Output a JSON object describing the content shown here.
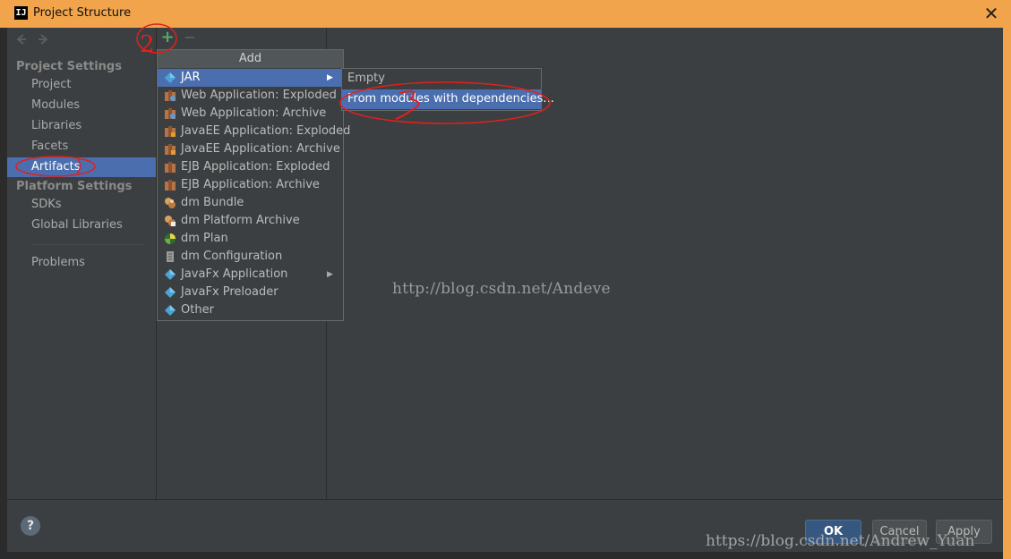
{
  "window": {
    "app_icon": "IJ",
    "title": "Project Structure",
    "close_glyph": "✕"
  },
  "sidebar": {
    "project_settings_heading": "Project Settings",
    "project_items": [
      {
        "label": "Project"
      },
      {
        "label": "Modules"
      },
      {
        "label": "Libraries"
      },
      {
        "label": "Facets"
      },
      {
        "label": "Artifacts",
        "selected": true
      }
    ],
    "platform_settings_heading": "Platform Settings",
    "platform_items": [
      {
        "label": "SDKs"
      },
      {
        "label": "Global Libraries"
      }
    ],
    "problems_label": "Problems"
  },
  "toolbar": {
    "add_glyph": "+",
    "remove_glyph": "−"
  },
  "add_menu": {
    "title": "Add",
    "items": [
      {
        "label": "JAR",
        "icon": "jar-icon",
        "submenu": true,
        "highlighted": true
      },
      {
        "label": "Web Application: Exploded",
        "icon": "web-app-icon"
      },
      {
        "label": "Web Application: Archive",
        "icon": "web-app-icon"
      },
      {
        "label": "JavaEE Application: Exploded",
        "icon": "javaee-icon"
      },
      {
        "label": "JavaEE Application: Archive",
        "icon": "javaee-icon"
      },
      {
        "label": "EJB Application: Exploded",
        "icon": "ejb-icon"
      },
      {
        "label": "EJB Application: Archive",
        "icon": "ejb-icon"
      },
      {
        "label": "dm Bundle",
        "icon": "dm-bundle-icon"
      },
      {
        "label": "dm Platform Archive",
        "icon": "dm-platform-icon"
      },
      {
        "label": "dm Plan",
        "icon": "dm-plan-icon"
      },
      {
        "label": "dm Configuration",
        "icon": "dm-config-icon"
      },
      {
        "label": "JavaFx Application",
        "icon": "javafx-icon",
        "submenu": true
      },
      {
        "label": "JavaFx Preloader",
        "icon": "javafx-icon"
      },
      {
        "label": "Other",
        "icon": "other-icon"
      }
    ]
  },
  "jar_submenu": {
    "items": [
      {
        "label": "Empty"
      },
      {
        "label": "From modules with dependencies...",
        "highlighted": true
      }
    ]
  },
  "watermarks": {
    "center": "http://blog.csdn.net/Andeve",
    "corner": "https://blog.csdn.net/Andrew_Yuan"
  },
  "footer": {
    "help_label": "?",
    "ok_label": "OK",
    "cancel_label": "Cancel",
    "apply_label": "Apply"
  },
  "annotations": {
    "step_two": "2",
    "color": "#e0211b"
  },
  "colors": {
    "title_bar": "#f1a44c",
    "background": "#3c3f41",
    "selection": "#4b6eaf",
    "add_green": "#59a869"
  }
}
